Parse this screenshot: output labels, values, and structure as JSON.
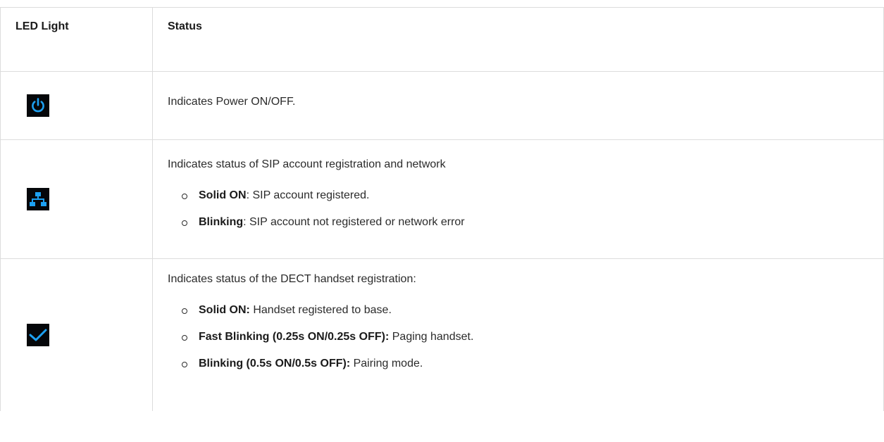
{
  "table": {
    "headers": {
      "led": "LED Light",
      "status": "Status"
    },
    "rows": [
      {
        "icon": "power-icon",
        "intro": "Indicates Power ON/OFF.",
        "states": []
      },
      {
        "icon": "network-icon",
        "intro": "Indicates status of SIP account registration and network",
        "states": [
          {
            "label": "Solid ON",
            "text": ": SIP account registered."
          },
          {
            "label": "Blinking",
            "text": ": SIP account not registered or network error"
          }
        ]
      },
      {
        "icon": "checkmark-icon",
        "intro": "Indicates status of the DECT handset registration:",
        "states": [
          {
            "label": "Solid ON:",
            "text": " Handset registered to base."
          },
          {
            "label": "Fast Blinking (0.25s ON/0.25s OFF):",
            "text": " Paging handset."
          },
          {
            "label": "Blinking (0.5s ON/0.5s OFF):",
            "text": " Pairing mode."
          }
        ]
      }
    ]
  },
  "colors": {
    "icon_accent": "#1da1f2",
    "icon_background": "#05070a",
    "border": "#dcdcdc"
  }
}
